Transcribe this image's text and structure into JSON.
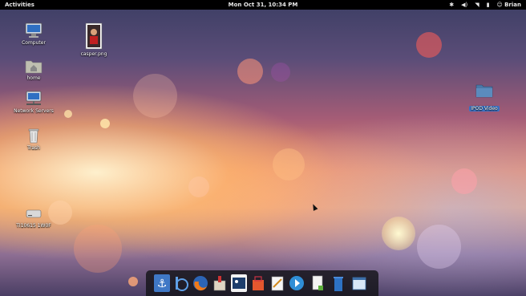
{
  "topbar": {
    "activities": "Activities",
    "clock": "Mon Oct 31, 10:34 PM",
    "user": "Brian"
  },
  "desktop_icons": [
    {
      "label": "Computer",
      "icon": "computer-icon"
    },
    {
      "label": "home",
      "icon": "home-folder-icon"
    },
    {
      "label": "Network Servers",
      "icon": "network-servers-icon"
    },
    {
      "label": "Trash",
      "icon": "trash-icon"
    },
    {
      "label": "TI10615 1W0F",
      "icon": "drive-icon"
    },
    {
      "label": "casper.png",
      "icon": "image-file-icon"
    },
    {
      "label": "IPOD Video",
      "icon": "folder-icon",
      "selected": true
    }
  ],
  "dock": {
    "items": [
      "anchor-icon",
      "bluetooth-app-icon",
      "firefox-icon",
      "software-center-icon",
      "image-viewer-icon",
      "app-bag-icon",
      "text-editor-icon",
      "media-player-icon",
      "document-icon",
      "trash-bin-icon",
      "window-icon"
    ]
  },
  "colors": {
    "topbar": "#000000",
    "selection": "#3b74c8"
  }
}
